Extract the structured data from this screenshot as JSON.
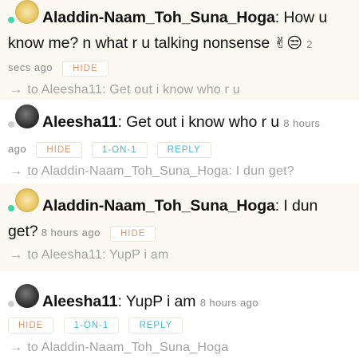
{
  "messages": [
    {
      "username": "Aladdin-Naam_Toh_Suna_Hoga",
      "status": "online",
      "avatar": "avatar-yellow",
      "text_line1": ": How u",
      "text_line2": "know me? n what r u talking nonsense",
      "emoji": "✌😒",
      "time_part1": "2",
      "time_part2": "secs ago",
      "buttons": [
        "HIDE"
      ],
      "reply_to": "to Aleesha11: Get out i know who r u"
    },
    {
      "username": "Aleesha11",
      "status": "offline",
      "avatar": "avatar-dark",
      "text": ": Get out i know who r u",
      "time_part1": "8 hours",
      "time_part2": "ago",
      "buttons": [
        "HIDE",
        "1-ON-1",
        "REPLY"
      ],
      "reply_to": "to Aladdin-Naam_Toh_Suna_Hoga: I dun get?"
    },
    {
      "username": "Aladdin-Naam_Toh_Suna_Hoga",
      "status": "online",
      "avatar": "avatar-yellow",
      "text_line1": ": I dun",
      "text_line2": "get?",
      "time": "8 hours ago",
      "buttons": [
        "HIDE"
      ],
      "reply_to": "to Aleesha11: YupP i am"
    },
    {
      "username": "Aleesha11",
      "status": "offline",
      "avatar": "avatar-dark",
      "text": ": YupP i am",
      "time": "8 hours ago",
      "buttons": [
        "HIDE",
        "1-ON-1",
        "REPLY"
      ],
      "reply_to": "to Aladdin-Naam_Toh_Suna_Hoga"
    }
  ],
  "icons": {
    "reply_arrow": "→"
  },
  "colors": {
    "online": "#3fd6a6",
    "offline": "#cfcfcf",
    "hide_button": "#e0956a",
    "action_button": "#46b7d5",
    "highlight_bg": "#fbf9f2"
  }
}
